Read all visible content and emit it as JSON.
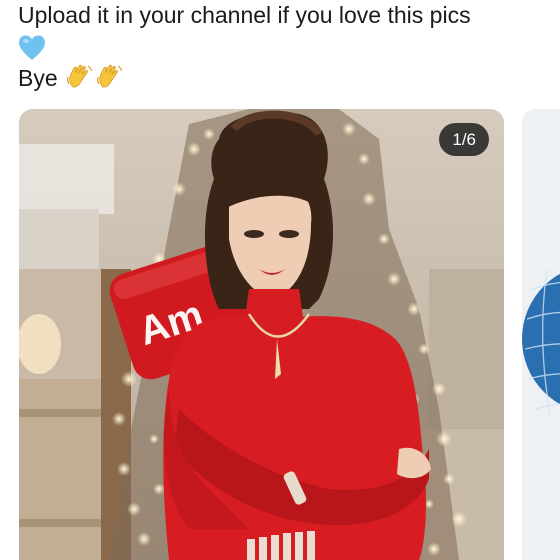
{
  "caption": {
    "line1": "Upload it in your channel if you love this pics",
    "line3": "Bye"
  },
  "icons": {
    "heart": "blue-heart-emoji",
    "wave": "waving-hand-emoji"
  },
  "carousel": {
    "counter": "1/6",
    "current_index": 1,
    "total": 6
  },
  "colors": {
    "dress": "#d81d22",
    "heart": "#6fc2f0",
    "wave": "#f5c53a",
    "counter_bg": "#191919"
  }
}
